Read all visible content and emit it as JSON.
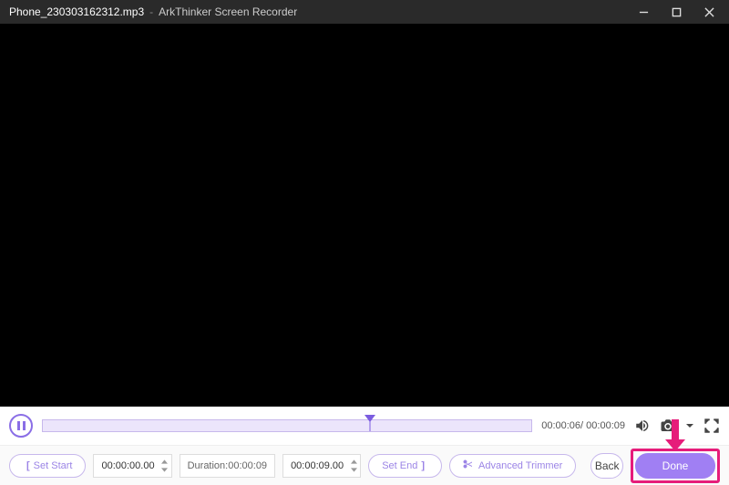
{
  "titlebar": {
    "filename": "Phone_230303162312.mp3",
    "separator": "-",
    "appname": "ArkThinker Screen Recorder"
  },
  "playback": {
    "current_time": "00:00:06",
    "total_time": "00:00:09",
    "progress_percent": 67
  },
  "trim": {
    "set_start_label": "Set Start",
    "start_time": "00:00:00.00",
    "duration_label": "Duration:",
    "duration_time": "00:00:09",
    "end_time": "00:00:09.00",
    "set_end_label": "Set End",
    "advanced_label": "Advanced Trimmer"
  },
  "actions": {
    "back": "Back",
    "done": "Done"
  }
}
